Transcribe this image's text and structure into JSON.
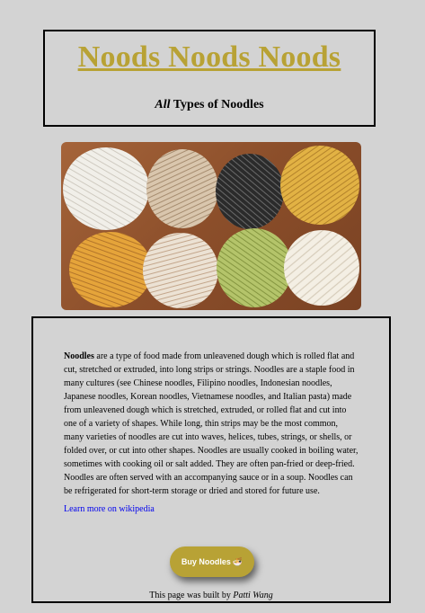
{
  "header": {
    "title": "Noods Noods Noods",
    "subtitle_emphasis": "All",
    "subtitle_rest": " Types of Noodles"
  },
  "hero": {
    "icon": "noodle-nests-photo"
  },
  "content": {
    "lead_word": "Noodles",
    "description": " are a type of food made from unleavened dough which is rolled flat and cut, stretched or extruded, into long strips or strings. Noodles are a staple food in many cultures (see Chinese noodles, Filipino noodles, Indonesian noodles, Japanese noodles, Korean noodles, Vietnamese noodles, and Italian pasta) made from unleavened dough which is stretched, extruded, or rolled flat and cut into one of a variety of shapes. While long, thin strips may be the most common, many varieties of noodles are cut into waves, helices, tubes, strings, or shells, or folded over, or cut into other shapes. Noodles are usually cooked in boiling water, sometimes with cooking oil or salt added. They are often pan-fried or deep-fried. Noodles are often served with an accompanying sauce or in a soup. Noodles can be refrigerated for short-term storage or dried and stored for future use.",
    "wiki_link": "Learn more on wikipedia",
    "buy_label": "Buy Noodles",
    "buy_icon": "🍜",
    "credit_prefix": "This page was built by ",
    "credit_author": "Patti Wang"
  },
  "colors": {
    "accent": "#b8a235",
    "background": "#d3d3d3",
    "link": "#0000ee"
  }
}
